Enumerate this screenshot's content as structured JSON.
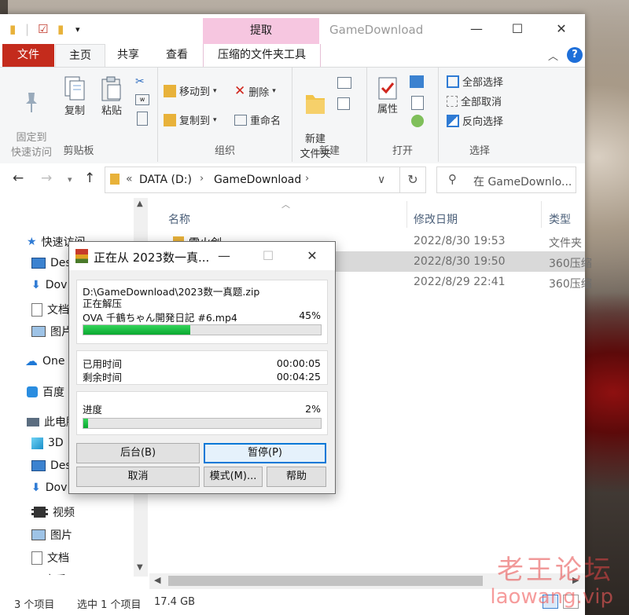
{
  "explorer": {
    "title": "GameDownload",
    "context_tab": "提取",
    "tabs": [
      "文件",
      "主页",
      "共享",
      "查看",
      "压缩的文件夹工具"
    ],
    "ribbon": {
      "clipboard": {
        "pin": "固定到\n快速访问",
        "copy": "复制",
        "paste": "粘贴",
        "label": "剪贴板"
      },
      "organize": {
        "move_to": "移动到",
        "copy_to": "复制到",
        "delete": "删除",
        "rename": "重命名",
        "label": "组织"
      },
      "new": {
        "new_folder": "新建\n文件夹",
        "label": "新建"
      },
      "open": {
        "properties": "属性",
        "label": "打开"
      },
      "select": {
        "select_all": "全部选择",
        "select_none": "全部取消",
        "invert": "反向选择",
        "label": "选择"
      }
    },
    "address": {
      "drive": "DATA (D:)",
      "folder": "GameDownload",
      "chevrons": "«",
      "search_placeholder": "在 GameDownlo..."
    },
    "nav_items": [
      {
        "label": "快速访问",
        "icon": "star-icon"
      },
      {
        "label": "Des",
        "icon": "desktop-icon"
      },
      {
        "label": "Dov",
        "icon": "download-icon"
      },
      {
        "label": "文档",
        "icon": "document-icon"
      },
      {
        "label": "图片",
        "icon": "picture-icon"
      },
      {
        "label": "One",
        "icon": "cloud-icon"
      },
      {
        "label": "百度",
        "icon": "baidu-icon"
      },
      {
        "label": "此电脑",
        "icon": "pc-icon"
      },
      {
        "label": "3D",
        "icon": "cube-icon"
      },
      {
        "label": "Des",
        "icon": "desktop-icon"
      },
      {
        "label": "Dov",
        "icon": "download-icon"
      },
      {
        "label": "视频",
        "icon": "video-icon"
      },
      {
        "label": "图片",
        "icon": "picture-icon"
      },
      {
        "label": "文档",
        "icon": "document-icon"
      },
      {
        "label": "音乐",
        "icon": "music-icon"
      }
    ],
    "columns": {
      "name": "名称",
      "date": "修改日期",
      "type": "类型"
    },
    "files": [
      {
        "name": "雷火剑",
        "date": "2022/8/30 19:53",
        "type": "文件夹"
      },
      {
        "name": "",
        "date": "2022/8/30 19:50",
        "type": "360压缩"
      },
      {
        "name": "",
        "date": "2022/8/29 22:41",
        "type": "360压缩"
      }
    ],
    "status": {
      "count": "3 个项目",
      "selected": "选中 1 个项目",
      "size": "17.4 GB"
    }
  },
  "dialog": {
    "title": "正在从 2023数一真...",
    "archive_path": "D:\\GameDownload\\2023数一真题.zip",
    "action": "正在解压",
    "current_file": "OVA 千鶴ちゃん開発日記 #6.mp4",
    "file_percent": "45%",
    "file_progress": 0.45,
    "elapsed_label": "已用时间",
    "elapsed_value": "00:00:05",
    "remaining_label": "剩余时间",
    "remaining_value": "00:04:25",
    "progress_label": "进度",
    "total_percent": "2%",
    "total_progress": 0.02,
    "buttons": {
      "background": "后台(B)",
      "pause": "暂停(P)",
      "cancel": "取消",
      "mode": "模式(M)...",
      "help": "帮助"
    }
  },
  "watermark": {
    "line1": "老王论坛",
    "line2": "laowang.vip"
  }
}
